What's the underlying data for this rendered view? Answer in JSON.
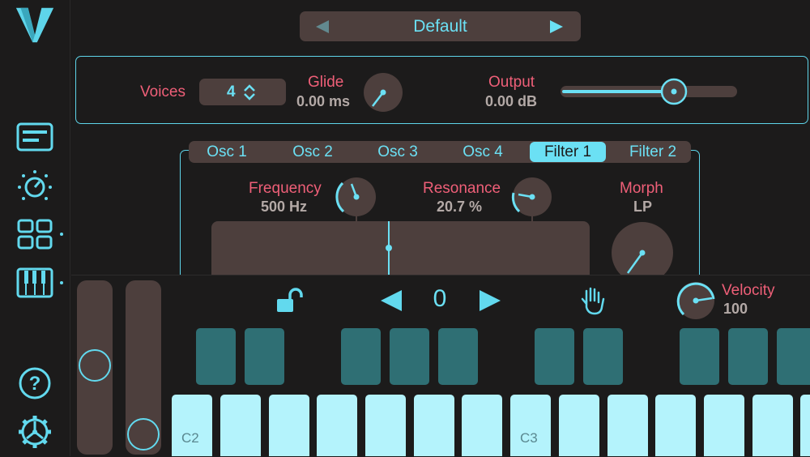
{
  "preset": {
    "name": "Default"
  },
  "voices": {
    "label": "Voices",
    "value": "4"
  },
  "glide": {
    "label": "Glide",
    "value": "0.00 ms"
  },
  "output": {
    "label": "Output",
    "value": "0.00 dB",
    "level": 0.71
  },
  "tabs": [
    {
      "label": "Osc 1",
      "active": false
    },
    {
      "label": "Osc 2",
      "active": false
    },
    {
      "label": "Osc 3",
      "active": false
    },
    {
      "label": "Osc 4",
      "active": false
    },
    {
      "label": "Filter 1",
      "active": true
    },
    {
      "label": "Filter 2",
      "active": false
    }
  ],
  "filter": {
    "frequency": {
      "label": "Frequency",
      "value": "500 Hz"
    },
    "resonance": {
      "label": "Resonance",
      "value": "20.7 %"
    },
    "morph": {
      "label": "Morph",
      "value": "LP"
    }
  },
  "keyboard": {
    "octave_shift": "0",
    "velocity": {
      "label": "Velocity",
      "value": "100"
    },
    "key_labels": {
      "c2": "C2",
      "c3": "C3"
    }
  },
  "colors": {
    "accent": "#6be0f4",
    "label": "#ef5f78",
    "panel": "#4d3f3d",
    "background": "#1c1b1b",
    "white_key": "#b4f3fc",
    "black_key": "#2f6f74"
  },
  "icons": [
    "logo-icon",
    "preset-editor-icon",
    "tuning-icon",
    "grid-icon",
    "keyboard-icon",
    "help-icon",
    "settings-icon",
    "unlock-icon",
    "hold-hand-icon"
  ]
}
